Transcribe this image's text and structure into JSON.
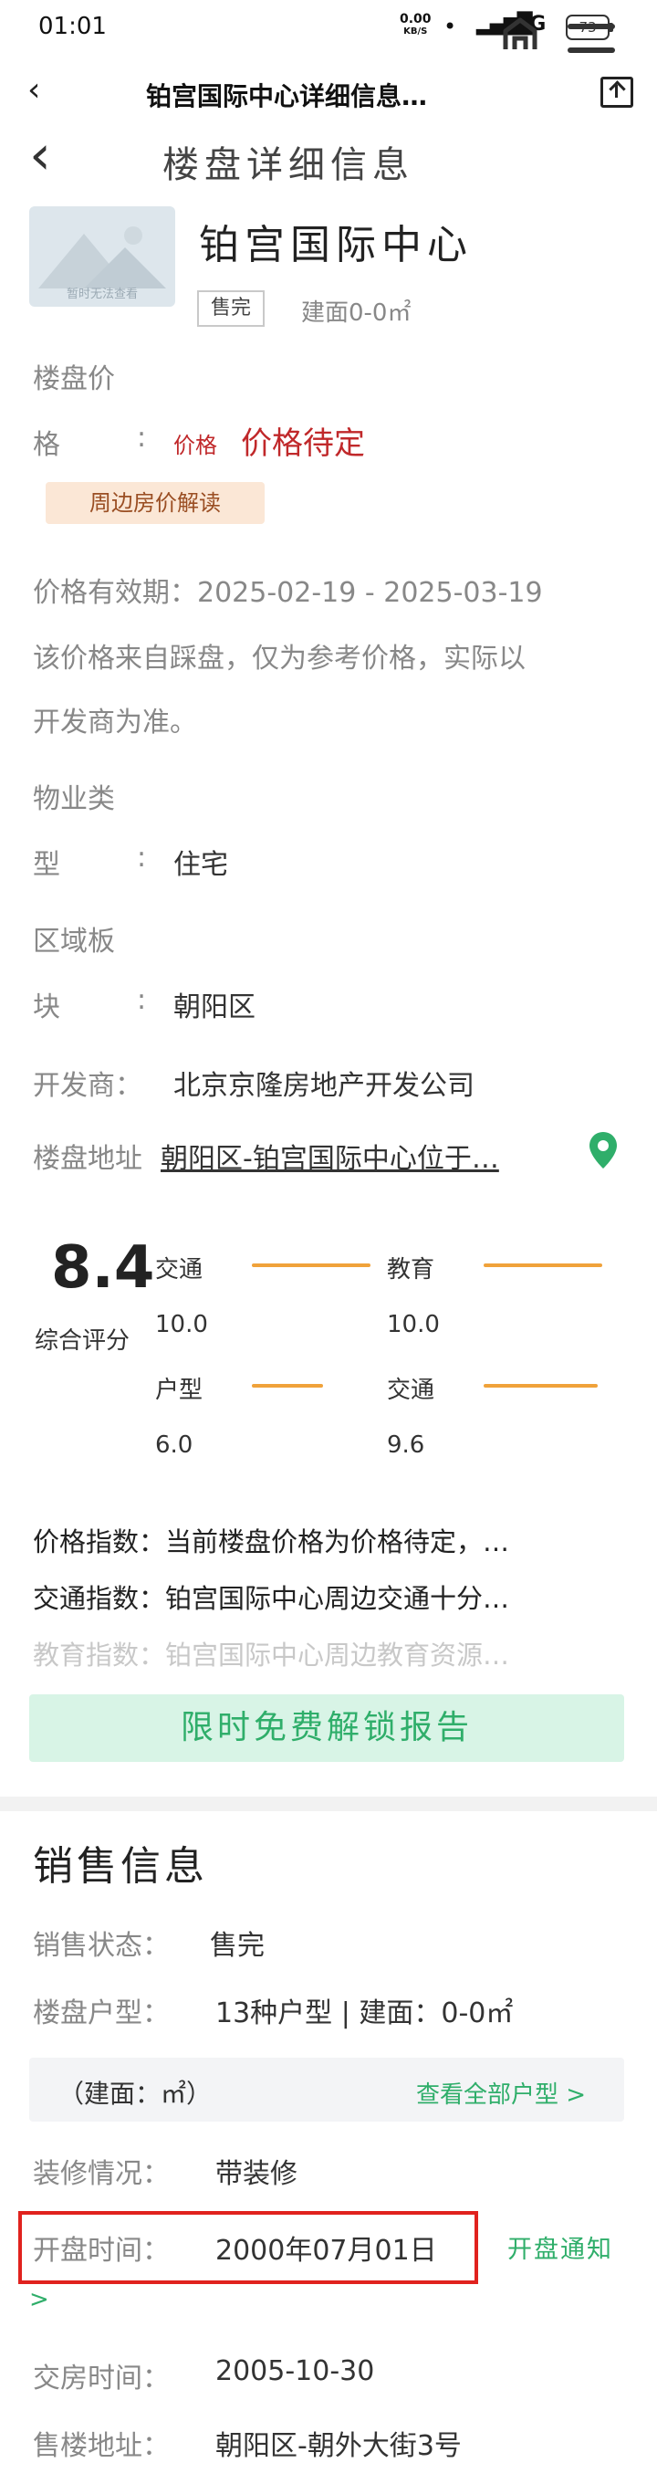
{
  "status_bar": {
    "time": "01:01",
    "net_speed_value": "0.00",
    "net_speed_unit": "KB/S",
    "network": "4G",
    "battery": "73"
  },
  "browser": {
    "title": "铂宫国际中心详细信息…"
  },
  "header": {
    "title": "楼盘详细信息"
  },
  "project": {
    "image_caption": "暂时无法查看",
    "name": "铂宫国际中心",
    "status_tag": "售完",
    "area": "建面0-0㎡"
  },
  "details": {
    "price_label_1": "楼盘价",
    "price_label_2": "格",
    "colon": ":",
    "price_prefix": "价格",
    "price_value": "价格待定",
    "price_badge": "周边房价解读",
    "validity": "价格有效期：2025-02-19 - 2025-03-19",
    "note_line1": "该价格来自踩盘，仅为参考价格，实际以",
    "note_line2": "开发商为准。",
    "property_label_1": "物业类",
    "property_label_2": "型",
    "property_value": "住宅",
    "district_label_1": "区域板",
    "district_label_2": "块",
    "district_value": "朝阳区",
    "developer_label": "开发商：",
    "developer_value": "北京京隆房地产开发公司",
    "address_label": "楼盘地址",
    "address_value": "朝阳区-铂宫国际中心位于…"
  },
  "scores": {
    "overall": "8.4",
    "overall_label": "综合评分",
    "items": [
      {
        "name": "交通",
        "value": "10.0",
        "level": 1.0
      },
      {
        "name": "教育",
        "value": "10.0",
        "level": 1.0
      },
      {
        "name": "户型",
        "value": "6.0",
        "level": 0.6
      },
      {
        "name": "交通",
        "value": "9.6",
        "level": 0.96
      }
    ]
  },
  "indices": [
    "价格指数：当前楼盘价格为价格待定，…",
    "交通指数：铂宫国际中心周边交通十分…",
    "教育指数：铂宫国际中心周边教育资源…"
  ],
  "unlock_button": "限时免费解锁报告",
  "sales": {
    "title": "销售信息",
    "status_label": "销售状态：",
    "status_value": "售完",
    "types_label": "楼盘户型：",
    "types_value": "13种户型 | 建面：0-0㎡",
    "box_left": "（建面：㎡）",
    "box_link": "查看全部户型 >",
    "decoration_label": "装修情况：",
    "decoration_value": "带装修",
    "open_label": "开盘时间：",
    "open_value": "2000年07月01日",
    "open_notify": "开盘通知",
    "open_notify_arrow": ">",
    "delivery_label": "交房时间：",
    "delivery_value": "2005-10-30",
    "sales_address_label": "售楼地址：",
    "sales_address_value": "朝阳区-朝外大街3号"
  },
  "colors": {
    "accent_green": "#2fae6a",
    "price_red": "#c0282a",
    "score_bar": "#f0a23a",
    "highlight_border": "#e0221e"
  }
}
